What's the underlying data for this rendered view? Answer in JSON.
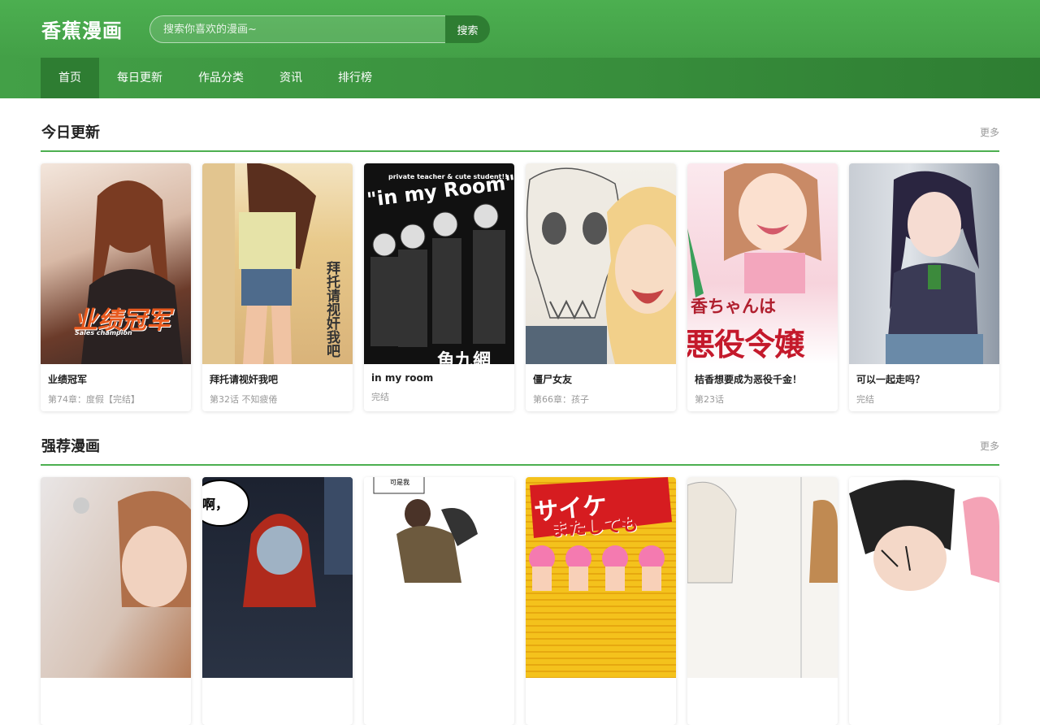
{
  "header": {
    "logo": "香蕉漫画",
    "search_placeholder": "搜索你喜欢的漫画~",
    "search_button": "搜索"
  },
  "nav": {
    "items": [
      {
        "label": "首页",
        "active": true
      },
      {
        "label": "每日更新",
        "active": false
      },
      {
        "label": "作品分类",
        "active": false
      },
      {
        "label": "资讯",
        "active": false
      },
      {
        "label": "排行榜",
        "active": false
      }
    ]
  },
  "sections": [
    {
      "title": "今日更新",
      "more": "更多",
      "items": [
        {
          "title": "业绩冠军",
          "subtitle": "第74章：度假【完结】",
          "cover_text": "业绩冠军",
          "cover_subtext": "Sales champion"
        },
        {
          "title": "拜托请视奸我吧",
          "subtitle": "第32话 不知疲倦",
          "cover_text": "拜托请视奸我吧"
        },
        {
          "title": "in my room",
          "subtitle": "完结",
          "cover_text": "\"in my Room\"",
          "cover_subtext": "private teacher & cute student!!",
          "cover_bottom": "魚九網"
        },
        {
          "title": "僵尸女友",
          "subtitle": "第66章：孩子"
        },
        {
          "title": "桔香想要成为恶役千金！",
          "subtitle": "第23话",
          "cover_text": "香ちゃんは",
          "cover_bottom": "悪役令嬢"
        },
        {
          "title": "可以一起走吗？",
          "subtitle": "完结"
        }
      ]
    },
    {
      "title": "强荐漫画",
      "more": "更多",
      "items": [
        {
          "title": "",
          "subtitle": ""
        },
        {
          "title": "",
          "subtitle": "",
          "cover_text": "啊，"
        },
        {
          "title": "",
          "subtitle": "",
          "cover_text": "可是我"
        },
        {
          "title": "",
          "subtitle": "",
          "cover_text": "サイケ",
          "cover_bottom": "またしても"
        },
        {
          "title": "",
          "subtitle": ""
        },
        {
          "title": "",
          "subtitle": ""
        }
      ]
    }
  ],
  "colors": {
    "brand": "#4caf50",
    "brand_dark": "#2e7d32"
  }
}
